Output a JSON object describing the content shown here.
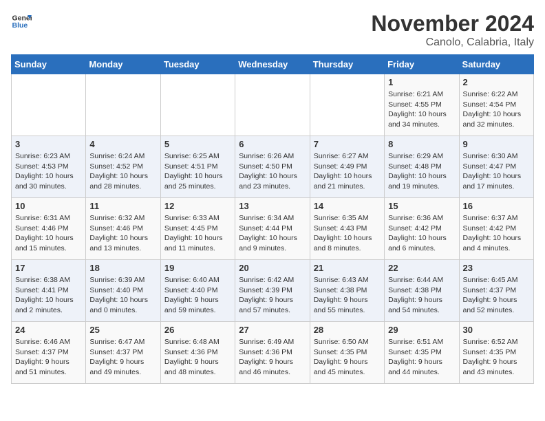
{
  "header": {
    "logo_general": "General",
    "logo_blue": "Blue",
    "title": "November 2024",
    "subtitle": "Canolo, Calabria, Italy"
  },
  "weekdays": [
    "Sunday",
    "Monday",
    "Tuesday",
    "Wednesday",
    "Thursday",
    "Friday",
    "Saturday"
  ],
  "weeks": [
    [
      {
        "day": "",
        "info": ""
      },
      {
        "day": "",
        "info": ""
      },
      {
        "day": "",
        "info": ""
      },
      {
        "day": "",
        "info": ""
      },
      {
        "day": "",
        "info": ""
      },
      {
        "day": "1",
        "info": "Sunrise: 6:21 AM\nSunset: 4:55 PM\nDaylight: 10 hours\nand 34 minutes."
      },
      {
        "day": "2",
        "info": "Sunrise: 6:22 AM\nSunset: 4:54 PM\nDaylight: 10 hours\nand 32 minutes."
      }
    ],
    [
      {
        "day": "3",
        "info": "Sunrise: 6:23 AM\nSunset: 4:53 PM\nDaylight: 10 hours\nand 30 minutes."
      },
      {
        "day": "4",
        "info": "Sunrise: 6:24 AM\nSunset: 4:52 PM\nDaylight: 10 hours\nand 28 minutes."
      },
      {
        "day": "5",
        "info": "Sunrise: 6:25 AM\nSunset: 4:51 PM\nDaylight: 10 hours\nand 25 minutes."
      },
      {
        "day": "6",
        "info": "Sunrise: 6:26 AM\nSunset: 4:50 PM\nDaylight: 10 hours\nand 23 minutes."
      },
      {
        "day": "7",
        "info": "Sunrise: 6:27 AM\nSunset: 4:49 PM\nDaylight: 10 hours\nand 21 minutes."
      },
      {
        "day": "8",
        "info": "Sunrise: 6:29 AM\nSunset: 4:48 PM\nDaylight: 10 hours\nand 19 minutes."
      },
      {
        "day": "9",
        "info": "Sunrise: 6:30 AM\nSunset: 4:47 PM\nDaylight: 10 hours\nand 17 minutes."
      }
    ],
    [
      {
        "day": "10",
        "info": "Sunrise: 6:31 AM\nSunset: 4:46 PM\nDaylight: 10 hours\nand 15 minutes."
      },
      {
        "day": "11",
        "info": "Sunrise: 6:32 AM\nSunset: 4:46 PM\nDaylight: 10 hours\nand 13 minutes."
      },
      {
        "day": "12",
        "info": "Sunrise: 6:33 AM\nSunset: 4:45 PM\nDaylight: 10 hours\nand 11 minutes."
      },
      {
        "day": "13",
        "info": "Sunrise: 6:34 AM\nSunset: 4:44 PM\nDaylight: 10 hours\nand 9 minutes."
      },
      {
        "day": "14",
        "info": "Sunrise: 6:35 AM\nSunset: 4:43 PM\nDaylight: 10 hours\nand 8 minutes."
      },
      {
        "day": "15",
        "info": "Sunrise: 6:36 AM\nSunset: 4:42 PM\nDaylight: 10 hours\nand 6 minutes."
      },
      {
        "day": "16",
        "info": "Sunrise: 6:37 AM\nSunset: 4:42 PM\nDaylight: 10 hours\nand 4 minutes."
      }
    ],
    [
      {
        "day": "17",
        "info": "Sunrise: 6:38 AM\nSunset: 4:41 PM\nDaylight: 10 hours\nand 2 minutes."
      },
      {
        "day": "18",
        "info": "Sunrise: 6:39 AM\nSunset: 4:40 PM\nDaylight: 10 hours\nand 0 minutes."
      },
      {
        "day": "19",
        "info": "Sunrise: 6:40 AM\nSunset: 4:40 PM\nDaylight: 9 hours\nand 59 minutes."
      },
      {
        "day": "20",
        "info": "Sunrise: 6:42 AM\nSunset: 4:39 PM\nDaylight: 9 hours\nand 57 minutes."
      },
      {
        "day": "21",
        "info": "Sunrise: 6:43 AM\nSunset: 4:38 PM\nDaylight: 9 hours\nand 55 minutes."
      },
      {
        "day": "22",
        "info": "Sunrise: 6:44 AM\nSunset: 4:38 PM\nDaylight: 9 hours\nand 54 minutes."
      },
      {
        "day": "23",
        "info": "Sunrise: 6:45 AM\nSunset: 4:37 PM\nDaylight: 9 hours\nand 52 minutes."
      }
    ],
    [
      {
        "day": "24",
        "info": "Sunrise: 6:46 AM\nSunset: 4:37 PM\nDaylight: 9 hours\nand 51 minutes."
      },
      {
        "day": "25",
        "info": "Sunrise: 6:47 AM\nSunset: 4:37 PM\nDaylight: 9 hours\nand 49 minutes."
      },
      {
        "day": "26",
        "info": "Sunrise: 6:48 AM\nSunset: 4:36 PM\nDaylight: 9 hours\nand 48 minutes."
      },
      {
        "day": "27",
        "info": "Sunrise: 6:49 AM\nSunset: 4:36 PM\nDaylight: 9 hours\nand 46 minutes."
      },
      {
        "day": "28",
        "info": "Sunrise: 6:50 AM\nSunset: 4:35 PM\nDaylight: 9 hours\nand 45 minutes."
      },
      {
        "day": "29",
        "info": "Sunrise: 6:51 AM\nSunset: 4:35 PM\nDaylight: 9 hours\nand 44 minutes."
      },
      {
        "day": "30",
        "info": "Sunrise: 6:52 AM\nSunset: 4:35 PM\nDaylight: 9 hours\nand 43 minutes."
      }
    ]
  ]
}
